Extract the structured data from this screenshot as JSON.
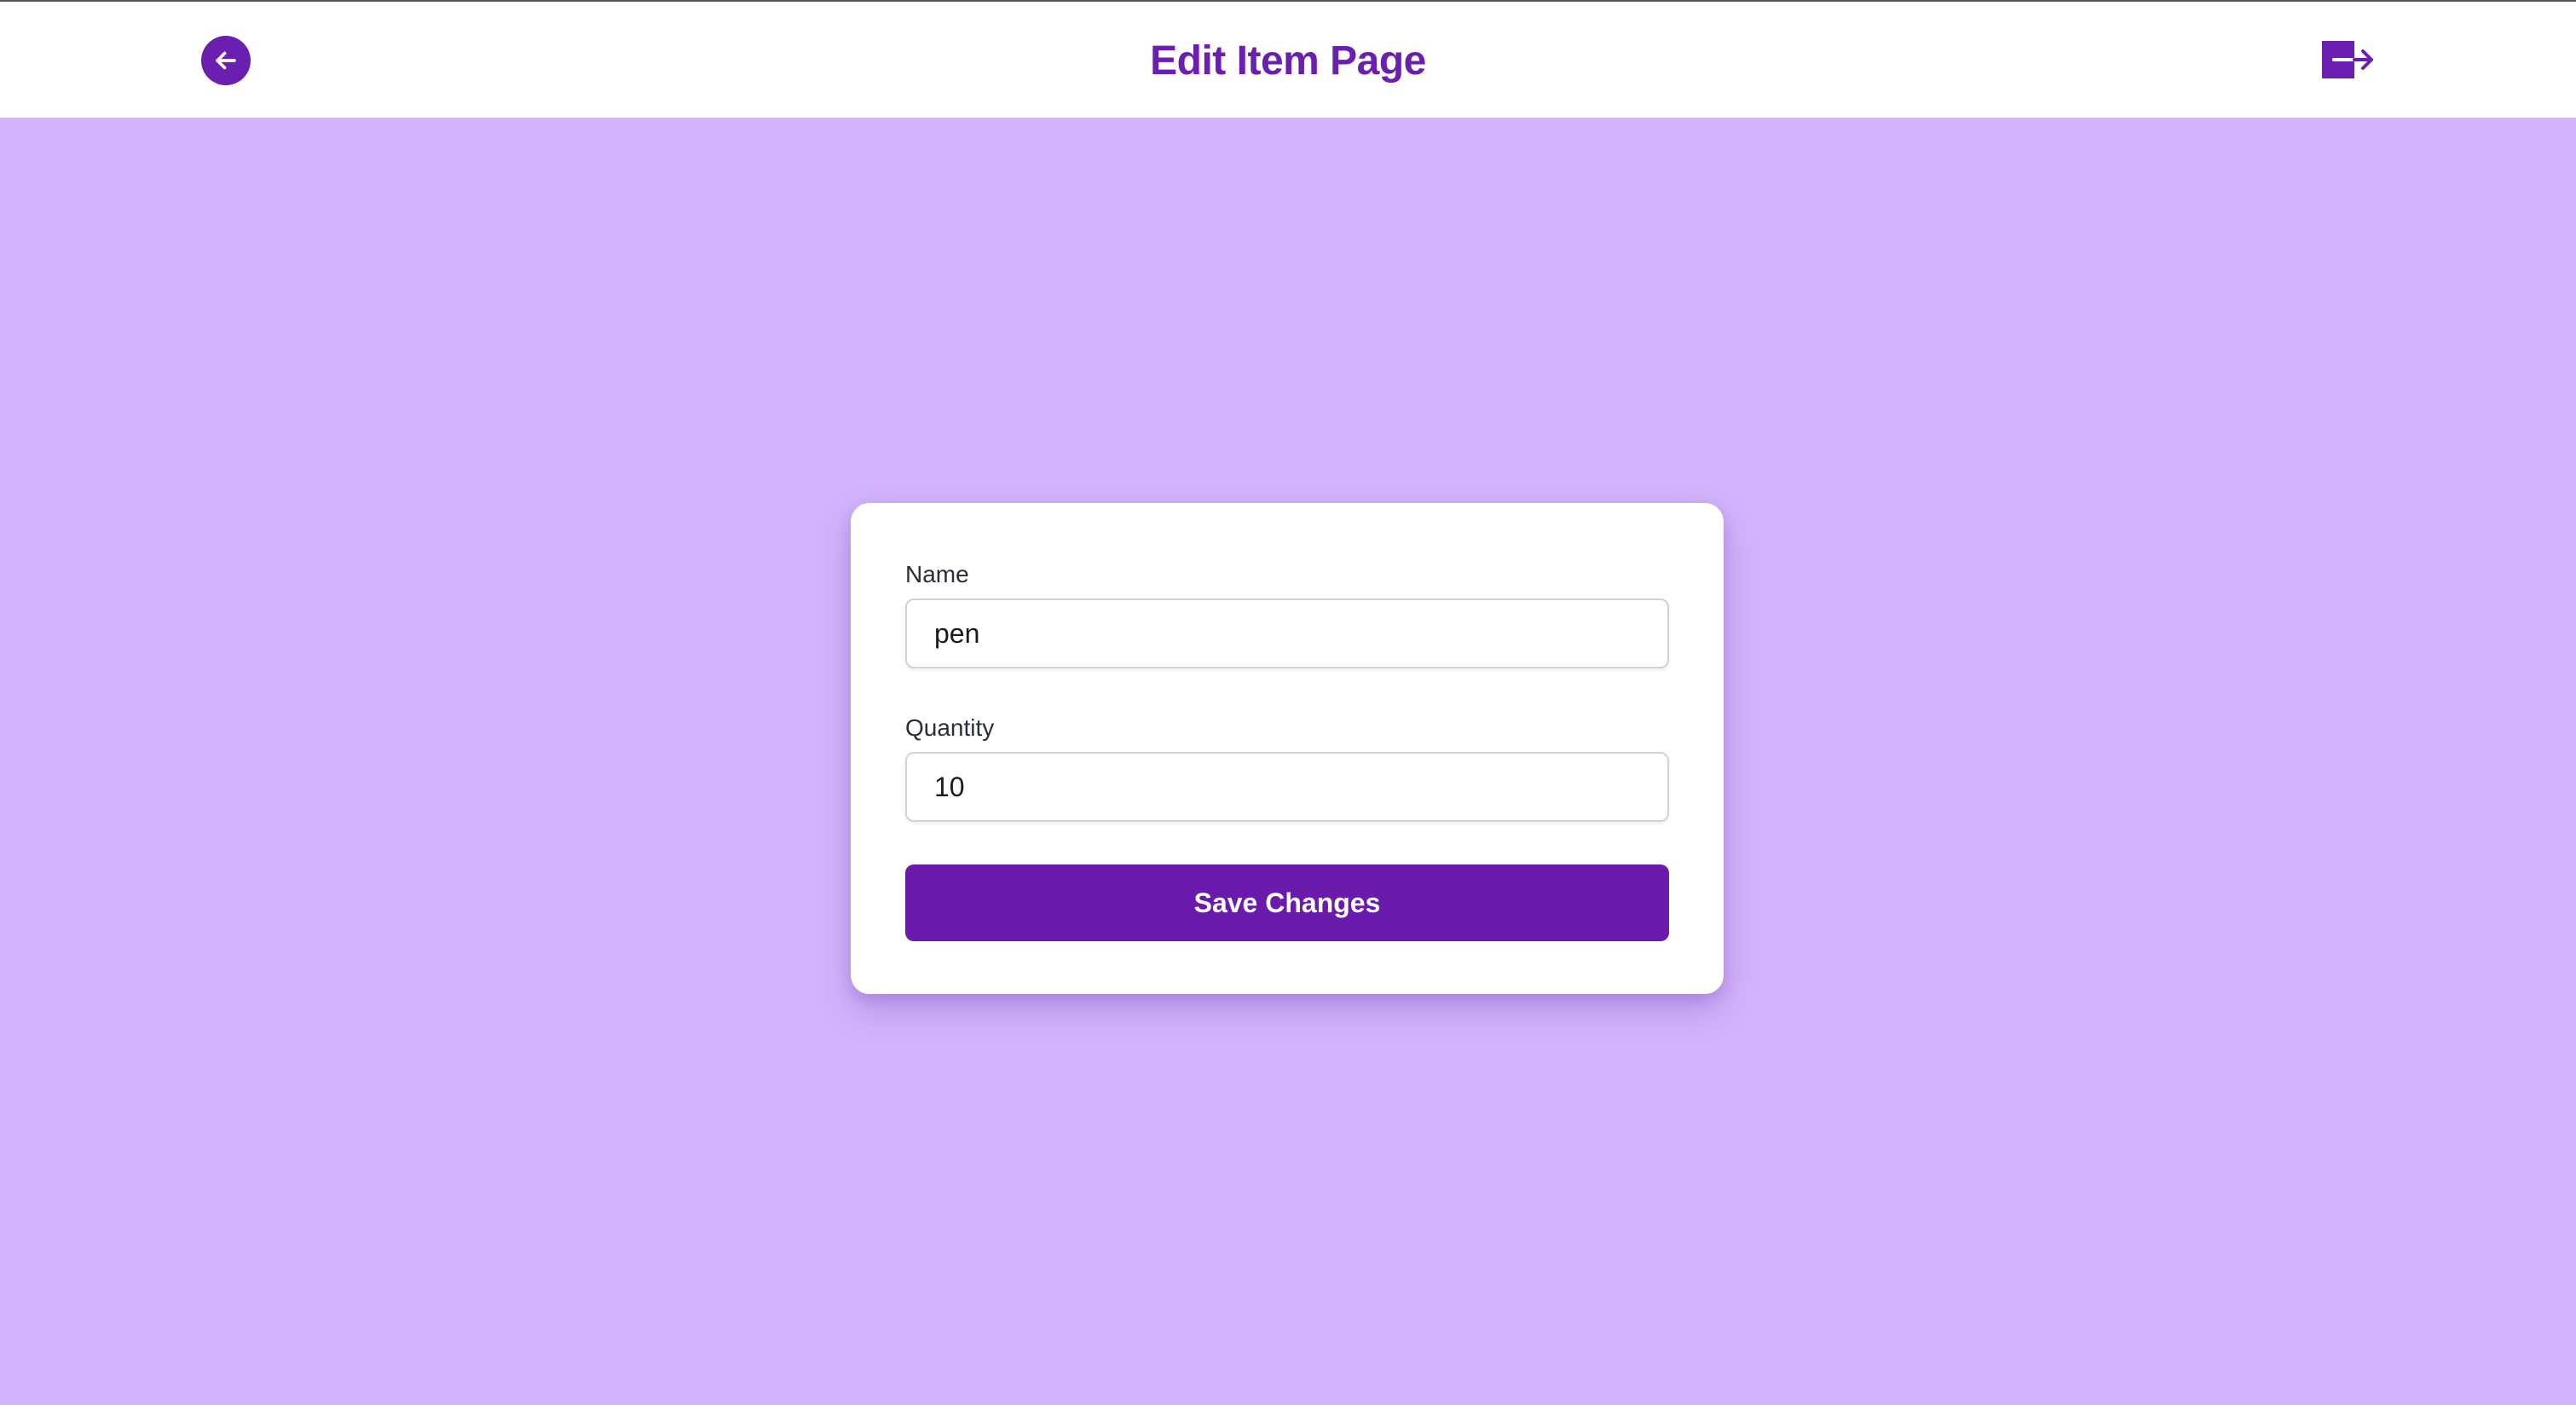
{
  "header": {
    "title": "Edit Item Page",
    "back_icon": "arrow-left-circle-icon",
    "logout_icon": "logout-icon"
  },
  "form": {
    "name_label": "Name",
    "name_value": "pen",
    "quantity_label": "Quantity",
    "quantity_value": "10",
    "save_label": "Save Changes"
  },
  "colors": {
    "background": "#d2b4fc",
    "accent": "#6a1fb0",
    "card": "#ffffff",
    "button": "#6a1bab"
  }
}
